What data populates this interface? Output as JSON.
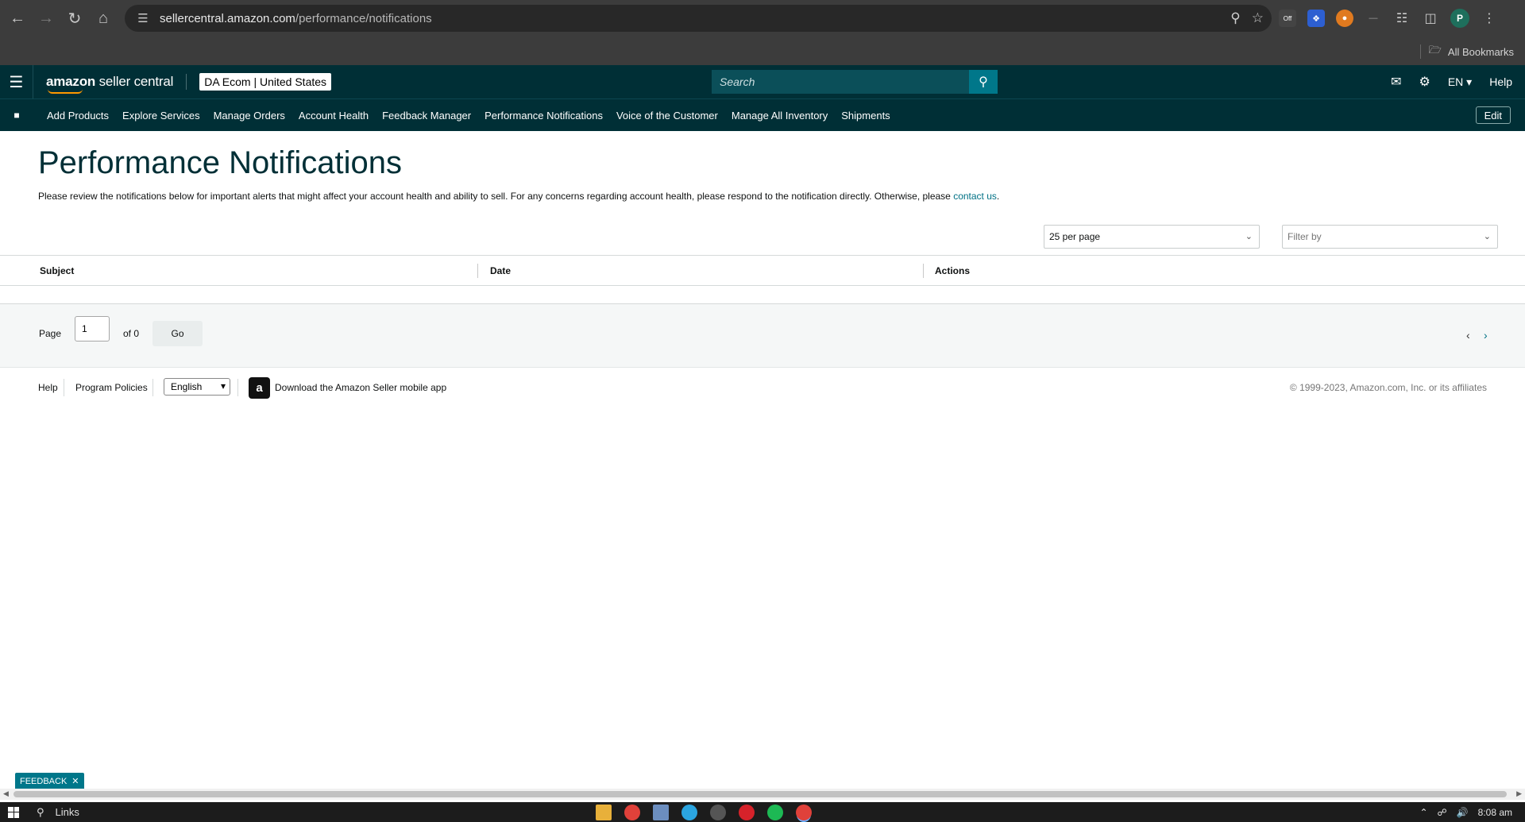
{
  "browser": {
    "url_host": "sellercentral.amazon.com",
    "url_path": "/performance/notifications",
    "all_bookmarks": "All Bookmarks",
    "ext_badge": "Off",
    "profile_initial": "P"
  },
  "header": {
    "logo_bold": "amazon",
    "logo_rest": " seller central",
    "account_name": "DA Ecom",
    "account_region": "United States",
    "search_placeholder": "Search",
    "language": "EN",
    "help": "Help"
  },
  "nav": {
    "items": [
      {
        "label": "Add Products"
      },
      {
        "label": "Explore Services"
      },
      {
        "label": "Manage Orders"
      },
      {
        "label": "Account Health"
      },
      {
        "label": "Feedback Manager"
      },
      {
        "label": "Performance Notifications"
      },
      {
        "label": "Voice of the Customer"
      },
      {
        "label": "Manage All Inventory"
      },
      {
        "label": "Shipments"
      }
    ],
    "edit": "Edit"
  },
  "main": {
    "title": "Performance Notifications",
    "intro": "Please review the notifications below for important alerts that might affect your account health and ability to sell. For any concerns regarding account health, please respond to the notification directly. Otherwise, please ",
    "intro_link": "contact us",
    "intro_end": ".",
    "per_page": "25 per page",
    "filter_placeholder": "Filter by",
    "columns": [
      "Subject",
      "Date",
      "Actions"
    ]
  },
  "pager": {
    "page_label": "Page",
    "page_value": "1",
    "of_label": "of 0",
    "go": "Go"
  },
  "footer": {
    "help": "Help",
    "program_policies": "Program Policies",
    "language": "English",
    "app_link": "Download the Amazon Seller mobile app",
    "copyright": "© 1999-2023, Amazon.com, Inc. or its affiliates"
  },
  "feedback": {
    "label": "FEEDBACK",
    "close": "✕"
  },
  "taskbar": {
    "search_label": "Links",
    "time": "8:08 am"
  },
  "colors": {
    "header_bg": "#002f36",
    "accent": "#00778a",
    "link": "#007185",
    "title": "#002f36"
  }
}
